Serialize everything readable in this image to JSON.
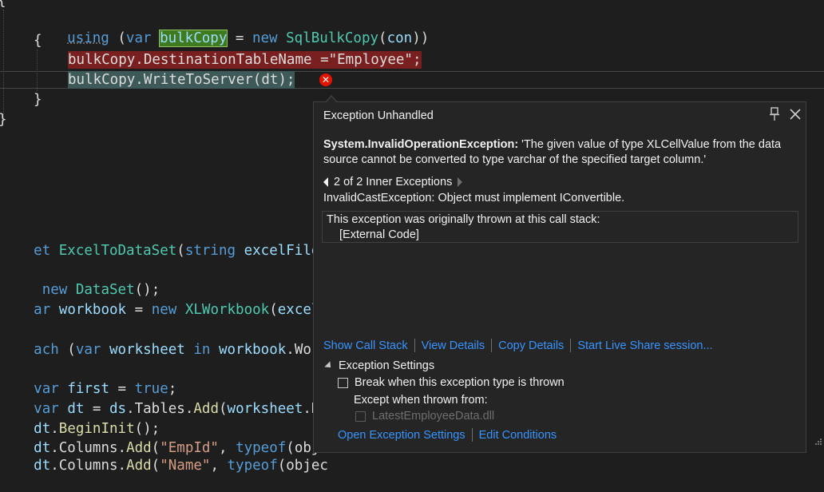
{
  "colors": {
    "editor_bg": "#1e1e1e",
    "keyword": "#569cd6",
    "type": "#4ec9b0",
    "variable": "#9cdcfe",
    "string": "#d69d85",
    "method": "#dcdcaa",
    "link": "#3794ff",
    "error": "#e51400",
    "popup_bg": "#252526"
  },
  "code": {
    "line_brace_top": "{",
    "line_using": {
      "kw_using": "using",
      "p1": " (",
      "kw_var": "var",
      "sp": " ",
      "var_name": "bulkCopy",
      "p2": " = ",
      "kw_new": "new",
      "sp2": " ",
      "type": "SqlBulkCopy",
      "p3": "(",
      "arg": "con",
      "p4": "))"
    },
    "line_open": "{",
    "line_dest": "bulkCopy.DestinationTableName =\"Employee\";",
    "line_write": "bulkCopy.WriteToServer(dt);",
    "line_close_inner": "}",
    "line_close_outer": "}",
    "line_method": {
      "a": "et ",
      "type": "ExcelToDataSet",
      "b": "(",
      "kw": "string",
      "c": " ",
      "param": "excelFileNa"
    },
    "line_dataset": {
      "a": " ",
      "kw": "new",
      "b": " ",
      "type": "DataSet",
      "c": "();"
    },
    "line_workbook": {
      "a": "ar",
      "b": " ",
      "var": "workbook",
      "c": " = ",
      "kw": "new",
      "d": " ",
      "type": "XLWorkbook",
      "e": "(",
      "arg": "excelFi"
    },
    "line_foreach": {
      "a": "ach",
      "b": " (",
      "kw": "var",
      "c": " ",
      "var": "worksheet",
      "d": " ",
      "kw2": "in",
      "e": " ",
      "var2": "workbook",
      "f": ".Works"
    },
    "line_first": {
      "kw": "var",
      "a": " ",
      "var": "first",
      "b": " = ",
      "kw2": "true",
      "c": ";"
    },
    "line_dt": {
      "kw": "var",
      "a": " ",
      "var": "dt",
      "b": " = ",
      "var2": "ds",
      "c": ".Tables.",
      "method": "Add",
      "d": "(",
      "var3": "worksheet",
      "e": ".Nam"
    },
    "line_begin": {
      "var": "dt",
      "a": ".",
      "method": "BeginInit",
      "b": "();"
    },
    "line_cols": {
      "var": "dt",
      "a": ".Columns.",
      "method": "Add",
      "b": "(",
      "str": "\"EmpId\"",
      "c": ", ",
      "kw": "typeof",
      "d": "(objec"
    },
    "line_cols2": {
      "var": "dt",
      "a": ".Columns.",
      "method": "Add",
      "b": "(",
      "str": "\"Name\"",
      "c": ", ",
      "kw": "typeof",
      "d": "(objec"
    }
  },
  "popup": {
    "title": "Exception Unhandled",
    "exception_type": "System.InvalidOperationException:",
    "exception_message": " 'The given value of type XLCellValue from the data source cannot be converted to type varchar of the specified target column.'",
    "inner_nav": "2 of 2 Inner Exceptions",
    "inner_message": "InvalidCastException: Object must implement IConvertible.",
    "stack_header": "This exception was originally thrown at this call stack:",
    "stack_item": "[External Code]",
    "links": {
      "show_call_stack": "Show Call Stack",
      "view_details": "View Details",
      "copy_details": "Copy Details",
      "live_share": "Start Live Share session..."
    },
    "settings_header": "Exception Settings",
    "break_label": "Break when this exception type is thrown",
    "except_label": "Except when thrown from:",
    "module_label": "LatestEmployeeData.dll",
    "open_settings": "Open Exception Settings",
    "edit_conditions": "Edit Conditions"
  },
  "icons": {
    "error": "error-circle-icon",
    "pin": "pin-icon",
    "close": "close-icon"
  }
}
